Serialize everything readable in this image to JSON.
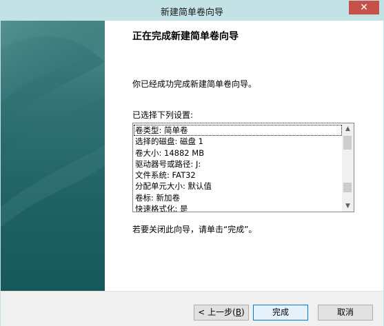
{
  "window": {
    "title": "新建简单卷向导",
    "close_glyph": "✕"
  },
  "page": {
    "heading": "正在完成新建简单卷向导",
    "intro": "你已经成功完成新建简单卷向导。",
    "list_label": "已选择下列设置:",
    "finish_hint": "若要关闭此向导，请单击“完成”。"
  },
  "settings_list": {
    "items": [
      "卷类型: 简单卷",
      "选择的磁盘: 磁盘 1",
      "卷大小: 14882 MB",
      "驱动器号或路径: J:",
      "文件系统: FAT32",
      "分配单元大小: 默认值",
      "卷标: 新加卷",
      "快速格式化: 是"
    ],
    "selected_index": 0,
    "scroll_up_glyph": "▲",
    "scroll_down_glyph": "▼"
  },
  "buttons": {
    "back_prefix": "< 上一步(",
    "back_key": "B",
    "back_suffix": ")",
    "finish": "完成",
    "cancel": "取消"
  }
}
